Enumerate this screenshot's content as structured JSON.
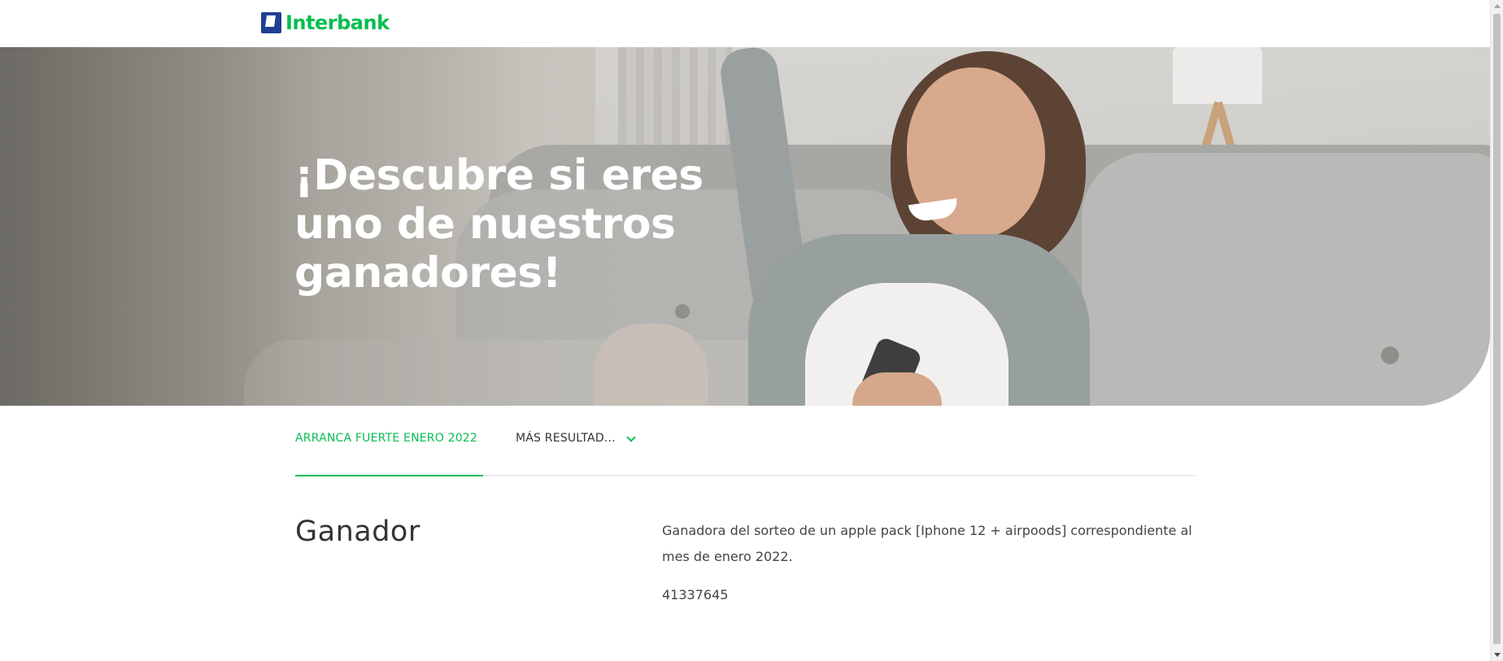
{
  "header": {
    "logo_text": "Interbank"
  },
  "hero": {
    "title": "¡Descubre si eres uno de nuestros ganadores!"
  },
  "tabs": {
    "active_label": "ARRANCA FUERTE ENERO 2022",
    "more_label": "MÁS RESULTAD..."
  },
  "content": {
    "heading": "Ganador",
    "description": "Ganadora del sorteo de un apple pack [Iphone 12 + airpoods] correspondiente al mes de enero 2022.",
    "winner_id": "41337645"
  },
  "colors": {
    "brand_green": "#05be50",
    "brand_blue": "#1e3f94"
  }
}
